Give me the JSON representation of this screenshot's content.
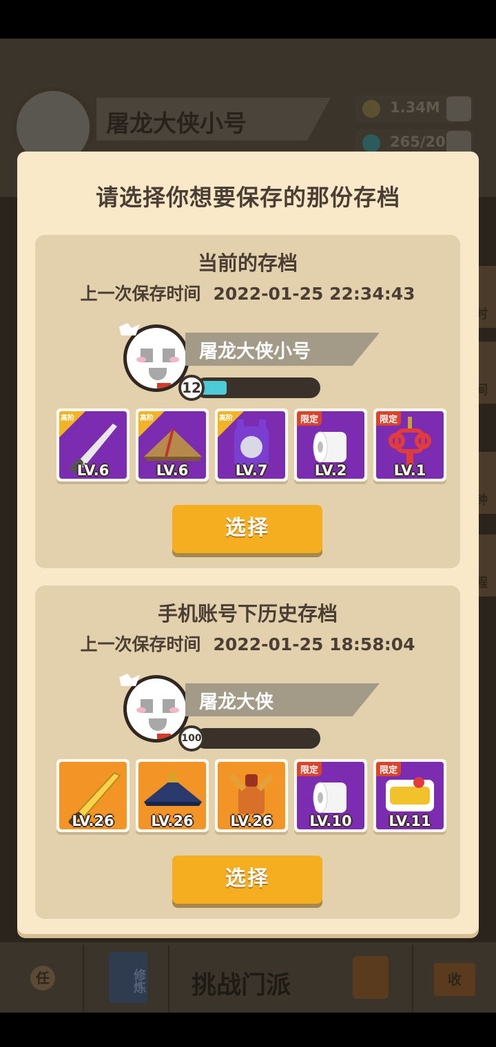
{
  "background": {
    "player_name": "屠龙大侠小号",
    "coins": "1.34M",
    "gems": "265/20",
    "side_labels": [
      "时",
      "间",
      "钟",
      "程"
    ],
    "nav": {
      "task_label": "任",
      "cultivate_label": "修炼",
      "challenge_label": "挑战门派",
      "collect_label": "收"
    }
  },
  "dialog": {
    "title": "请选择你想要保存的那份存档",
    "saves": [
      {
        "heading": "当前的存档",
        "time_label": "上一次保存时间",
        "time_value": "2022-01-25 22:34:43",
        "player_name": "屠龙大侠小号",
        "level": "12",
        "xp_fraction": 0.2,
        "items": [
          {
            "icon": "saber-icon",
            "rarity": "purple",
            "tag": "高阶",
            "tag_type": "adv",
            "level": "LV.6"
          },
          {
            "icon": "straw-hat-icon",
            "rarity": "purple",
            "tag": "高阶",
            "tag_type": "adv",
            "level": "LV.6"
          },
          {
            "icon": "armor-vest-icon",
            "rarity": "purple",
            "tag": "高阶",
            "tag_type": "adv",
            "level": "LV.7"
          },
          {
            "icon": "toilet-paper-icon",
            "rarity": "purple",
            "tag": "限定",
            "tag_type": "lim",
            "level": "LV.2"
          },
          {
            "icon": "chinese-knot-icon",
            "rarity": "purple",
            "tag": "限定",
            "tag_type": "lim",
            "level": "LV.1"
          }
        ],
        "button_label": "选择"
      },
      {
        "heading": "手机账号下历史存档",
        "time_label": "上一次保存时间",
        "time_value": "2022-01-25 18:58:04",
        "player_name": "屠龙大侠",
        "level": "100",
        "xp_fraction": 0.0,
        "items": [
          {
            "icon": "golden-sword-icon",
            "rarity": "orange",
            "tag": "",
            "tag_type": "",
            "level": "LV.26"
          },
          {
            "icon": "blue-hat-icon",
            "rarity": "orange",
            "tag": "",
            "tag_type": "",
            "level": "LV.26"
          },
          {
            "icon": "samurai-armor-icon",
            "rarity": "orange",
            "tag": "",
            "tag_type": "",
            "level": "LV.26"
          },
          {
            "icon": "toilet-paper-icon",
            "rarity": "purple",
            "tag": "限定",
            "tag_type": "lim",
            "level": "LV.10"
          },
          {
            "icon": "snack-bag-icon",
            "rarity": "purple",
            "tag": "限定",
            "tag_type": "lim",
            "level": "LV.11"
          }
        ],
        "button_label": "选择"
      }
    ]
  }
}
